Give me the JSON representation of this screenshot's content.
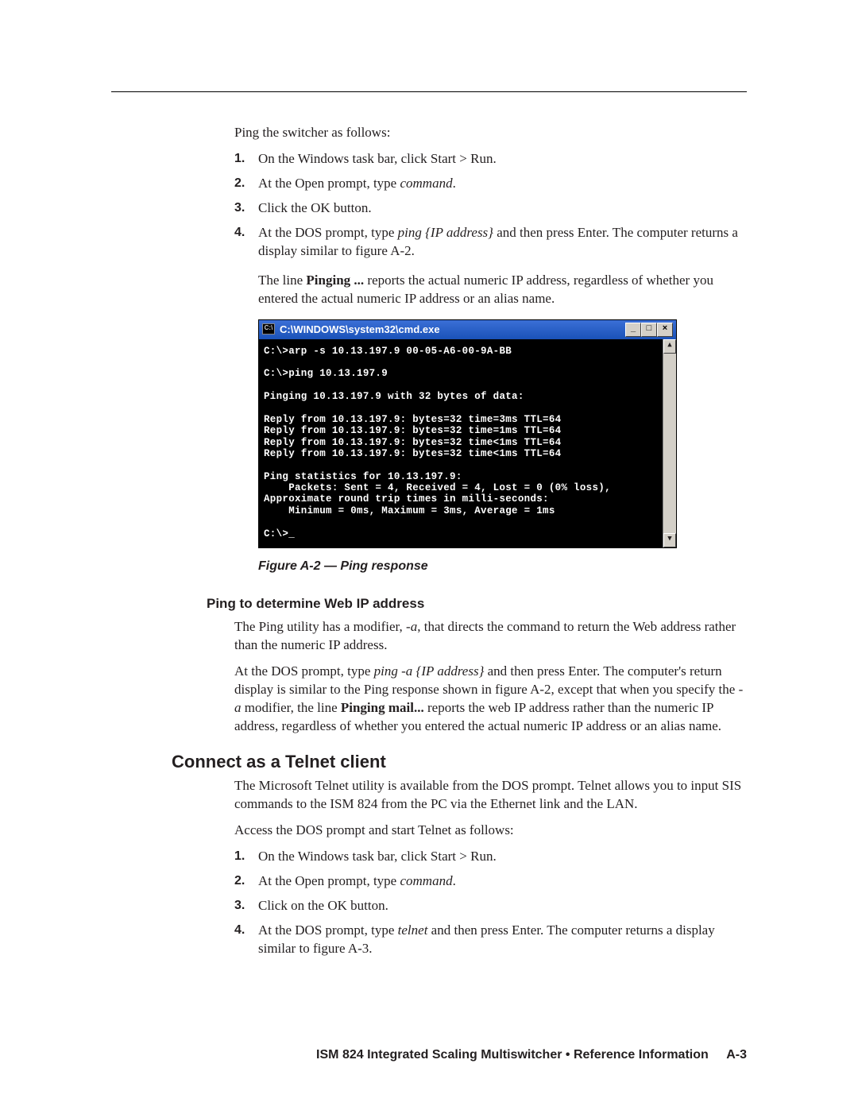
{
  "intro": "Ping the switcher as follows:",
  "list1": [
    {
      "n": "1.",
      "t": "On the Windows task bar, click Start > Run."
    },
    {
      "n": "2.",
      "pre": "At the Open prompt, type ",
      "it": "command",
      "post": "."
    },
    {
      "n": "3.",
      "t": "Click the OK button."
    },
    {
      "n": "4.",
      "pre": "At the DOS prompt, type ",
      "it": "ping {IP address}",
      "post": " and then press Enter.  The computer returns a display similar to figure A-2."
    }
  ],
  "sub4a_pre": "The line ",
  "sub4a_bold": "Pinging ...",
  "sub4a_post": " reports the actual numeric IP address, regardless of whether you entered the actual numeric IP address or an alias name.",
  "cmd_title": "C:\\WINDOWS\\system32\\cmd.exe",
  "cmd_icon": "C:\\",
  "cmd_body": "C:\\>arp -s 10.13.197.9 00-05-A6-00-9A-BB\n\nC:\\>ping 10.13.197.9\n\nPinging 10.13.197.9 with 32 bytes of data:\n\nReply from 10.13.197.9: bytes=32 time=3ms TTL=64\nReply from 10.13.197.9: bytes=32 time=1ms TTL=64\nReply from 10.13.197.9: bytes=32 time<1ms TTL=64\nReply from 10.13.197.9: bytes=32 time<1ms TTL=64\n\nPing statistics for 10.13.197.9:\n    Packets: Sent = 4, Received = 4, Lost = 0 (0% loss),\nApproximate round trip times in milli-seconds:\n    Minimum = 0ms, Maximum = 3ms, Average = 1ms\n\nC:\\>_",
  "figcap": "Figure A-2 — Ping response",
  "subhead1": "Ping to determine Web IP address",
  "p_ping1_pre": "The Ping utility has a modifier, ",
  "p_ping1_it": "-a",
  "p_ping1_post": ", that directs the command to return the Web address rather than the numeric IP address.",
  "p_ping2_pre": "At the DOS prompt, type ",
  "p_ping2_it": "ping -a {IP address}",
  "p_ping2_mid": " and then press Enter.  The computer's return display is similar to the Ping response shown in figure A-2, except that when you specify the ",
  "p_ping2_it2": "-a",
  "p_ping2_mid2": " modifier, the line ",
  "p_ping2_bold": "Pinging mail...",
  "p_ping2_post": " reports the web IP address rather than the numeric IP address, regardless of whether you entered the actual numeric IP address or an alias name.",
  "h2": "Connect as a Telnet client",
  "p_tel1": "The Microsoft Telnet utility is available from the DOS prompt.  Telnet allows you to input SIS commands to the ISM 824 from the PC via the Ethernet link and the LAN.",
  "p_tel2": "Access the DOS prompt and start Telnet as follows:",
  "list2": [
    {
      "n": "1.",
      "t": "On the Windows task bar, click Start > Run."
    },
    {
      "n": "2.",
      "pre": "At the Open prompt, type ",
      "it": "command",
      "post": "."
    },
    {
      "n": "3.",
      "t": "Click on the OK button."
    },
    {
      "n": "4.",
      "pre": "At the DOS prompt, type ",
      "it": "telnet",
      "post": " and then press Enter.  The computer returns a display similar to figure A-3."
    }
  ],
  "footer_text": "ISM 824 Integrated Scaling Multiswitcher • Reference Information",
  "footer_page": "A-3",
  "btn_min": "_",
  "btn_max": "□",
  "btn_close": "×",
  "arrow_up": "▲",
  "arrow_down": "▼"
}
